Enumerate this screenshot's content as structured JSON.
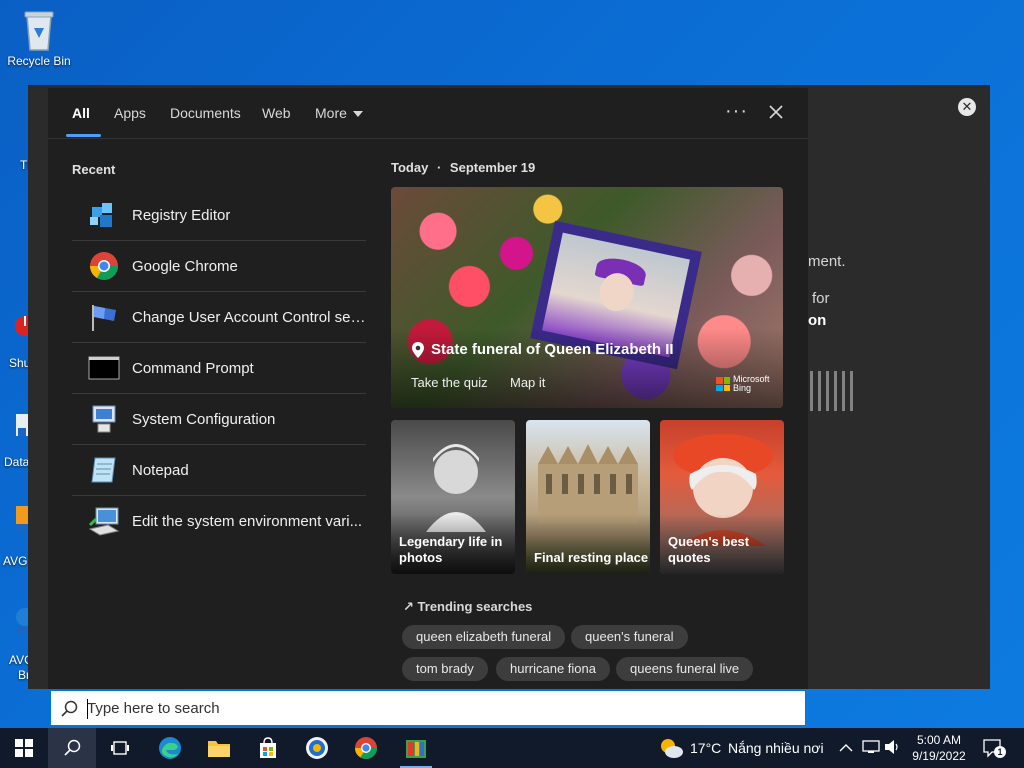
{
  "desktop": {
    "recycle_bin_label": "Recycle Bin",
    "edge_labels": [
      "Th",
      "Shu",
      "Data",
      "AVG",
      "AVG",
      "Br"
    ]
  },
  "background_window": {
    "lines": [
      "ment.",
      "for",
      "on"
    ]
  },
  "search": {
    "tabs": [
      "All",
      "Apps",
      "Documents",
      "Web",
      "More"
    ],
    "active_tab": "All",
    "recent_title": "Recent",
    "recent_items": [
      {
        "label": "Registry Editor",
        "icon": "registry-editor-icon"
      },
      {
        "label": "Google Chrome",
        "icon": "chrome-icon"
      },
      {
        "label": "Change User Account Control set...",
        "icon": "uac-flag-icon"
      },
      {
        "label": "Command Prompt",
        "icon": "command-prompt-icon"
      },
      {
        "label": "System Configuration",
        "icon": "system-configuration-icon"
      },
      {
        "label": "Notepad",
        "icon": "notepad-icon"
      },
      {
        "label": "Edit the system environment vari...",
        "icon": "system-properties-icon"
      }
    ],
    "today_label": "Today",
    "today_date": "September 19",
    "hero": {
      "title": "State funeral of Queen Elizabeth II",
      "links": [
        "Take the quiz",
        "Map it"
      ],
      "brand_line1": "Microsoft",
      "brand_line2": "Bing"
    },
    "tiles": [
      {
        "caption_line1": "Legendary life in",
        "caption_line2": "photos"
      },
      {
        "caption_line1": "Final resting place",
        "caption_line2": ""
      },
      {
        "caption_line1": "Queen's best",
        "caption_line2": "quotes"
      }
    ],
    "trending_title": "Trending searches",
    "trending": [
      "queen elizabeth funeral",
      "queen's funeral",
      "tom brady",
      "hurricane fiona",
      "queens funeral live"
    ],
    "placeholder": "Type here to search"
  },
  "taskbar": {
    "weather_temp": "17°C",
    "weather_desc": "Nắng nhiều nơi",
    "time": "5:00 AM",
    "date": "9/19/2022",
    "notification_count": "1"
  }
}
